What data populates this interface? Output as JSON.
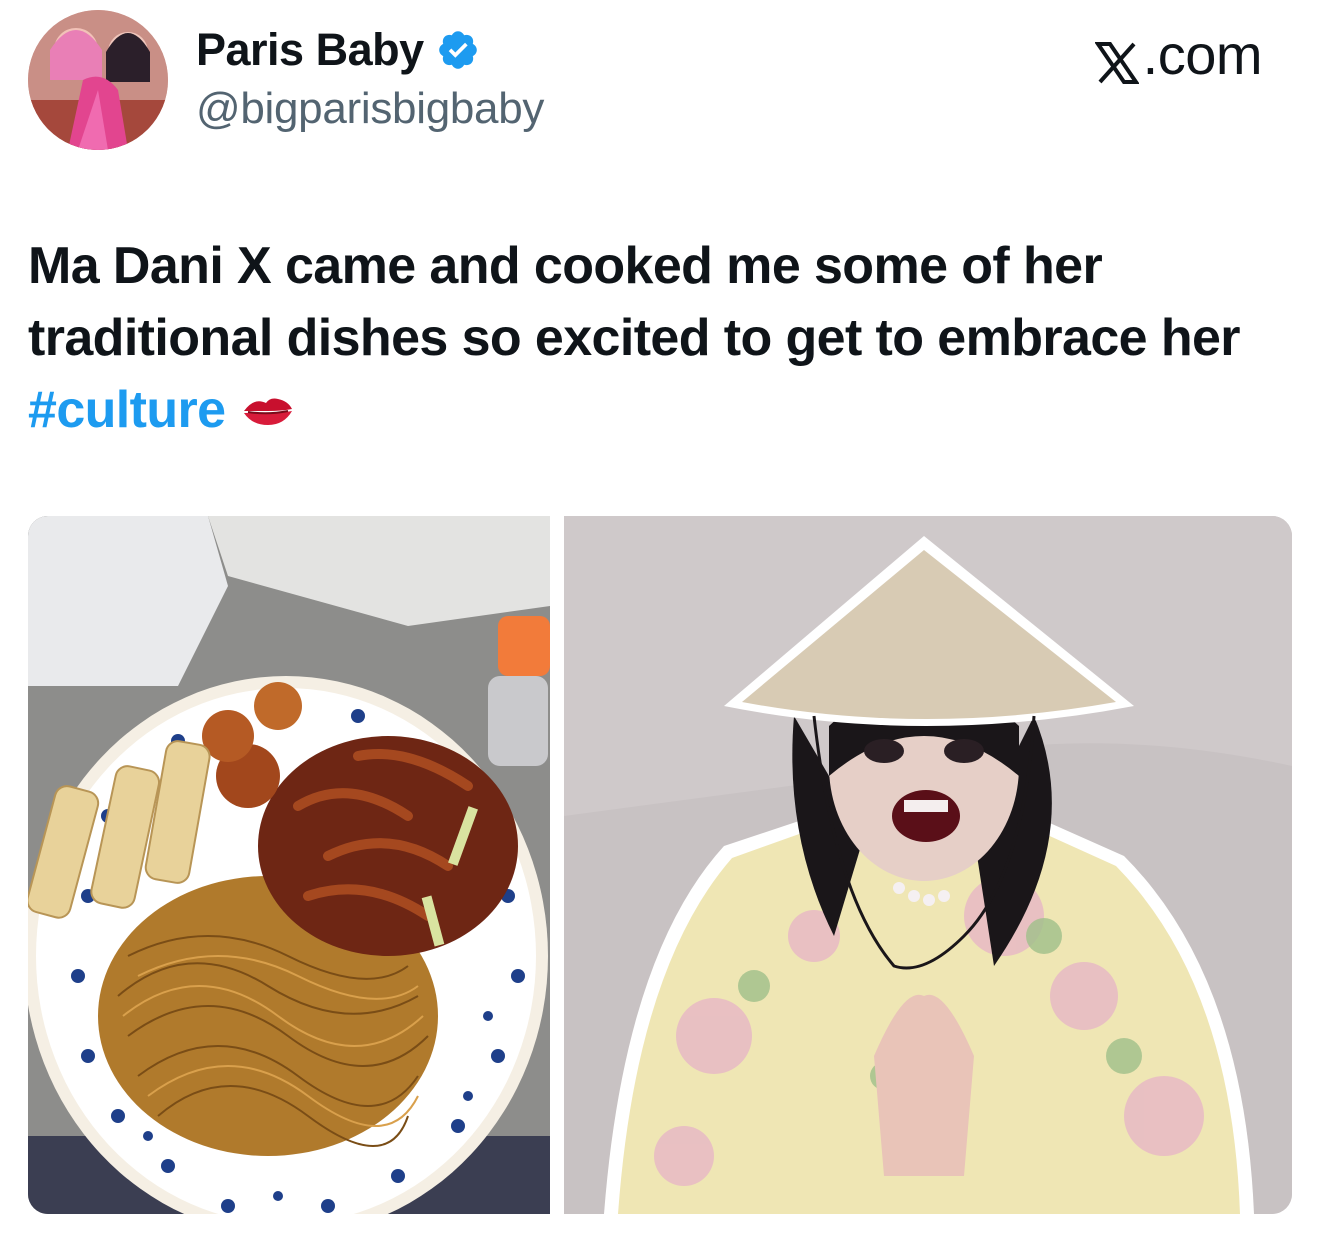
{
  "tweet": {
    "author": {
      "display_name": "Paris Baby",
      "handle": "@bigparisbigbaby",
      "verified": true,
      "avatar_icon": "profile-photo"
    },
    "source_label": ".com",
    "source_logo": "x-logo-icon",
    "text": {
      "main": "Ma Dani X came and cooked me some of her traditional dishes so excited to get to embrace her ",
      "hashtag": "#culture",
      "emoji": "kiss-mark-icon"
    },
    "media": [
      {
        "kind": "photo",
        "subject": "plate-of-noodles-spring-rolls-and-sweet-and-sour-dish"
      },
      {
        "kind": "photo",
        "subject": "person-in-conical-hat-and-floral-robe"
      }
    ]
  },
  "colors": {
    "text": "#0f1419",
    "secondary": "#536471",
    "link": "#1d9bf0",
    "verified_badge": "#1d9bf0"
  }
}
